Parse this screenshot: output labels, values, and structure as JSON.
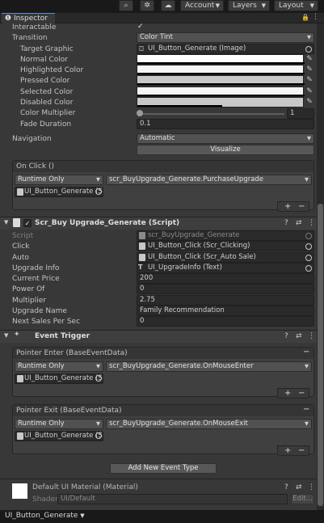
{
  "toolbar": {
    "account_label": "Account",
    "layers_label": "Layers",
    "layout_label": "Layout"
  },
  "tab": {
    "title": "Inspector"
  },
  "button_section": {
    "interactable_label": "Interactable",
    "interactable_checked": "✓",
    "transition_label": "Transition",
    "transition_value": "Color Tint",
    "target_graphic_label": "Target Graphic",
    "target_graphic_value": "UI_Button_Generate (Image)",
    "normal_color_label": "Normal Color",
    "highlighted_color_label": "Highlighted Color",
    "pressed_color_label": "Pressed Color",
    "selected_color_label": "Selected Color",
    "disabled_color_label": "Disabled Color",
    "color_multiplier_label": "Color Multiplier",
    "color_multiplier_value": "1",
    "fade_duration_label": "Fade Duration",
    "fade_duration_value": "0.1",
    "navigation_label": "Navigation",
    "navigation_value": "Automatic",
    "visualize_label": "Visualize",
    "onclick_header": "On Click ()",
    "onclick_runtime": "Runtime Only",
    "onclick_function": "scr_BuyUpgrade_Generate.PurchaseUpgrade",
    "onclick_object": "UI_Button_Generate (Sc"
  },
  "script_component": {
    "title": "Scr_Buy Upgrade_Generate (Script)",
    "fields": [
      {
        "label": "Script",
        "value": "scr_BuyUpgrade_Generate",
        "dim": true
      },
      {
        "label": "Click",
        "value": "UI_Button_Click (Scr_Clicking)"
      },
      {
        "label": "Auto",
        "value": "UI_Button_Click (Scr_Auto Sale)"
      },
      {
        "label": "Upgrade Info",
        "value": "UI_UpgradeInfo (Text)"
      },
      {
        "label": "Current Price",
        "value": "200"
      },
      {
        "label": "Power Of",
        "value": "0"
      },
      {
        "label": "Multiplier",
        "value": "2.75"
      },
      {
        "label": "Upgrade Name",
        "value": "Family Recommendation"
      },
      {
        "label": "Next Sales Per Sec",
        "value": "0"
      }
    ]
  },
  "event_trigger": {
    "title": "Event Trigger",
    "entries": [
      {
        "header": "Pointer Enter (BaseEventData)",
        "runtime": "Runtime Only",
        "function": "scr_BuyUpgrade_Generate.OnMouseEnter",
        "object": "UI_Button_Generate (Sc"
      },
      {
        "header": "Pointer Exit (BaseEventData)",
        "runtime": "Runtime Only",
        "function": "scr_BuyUpgrade_Generate.OnMouseExit",
        "object": "UI_Button_Generate (Sc"
      }
    ],
    "add_event_label": "Add New Event Type"
  },
  "material": {
    "title": "Default UI Material (Material)",
    "shader_label": "Shader",
    "shader_value": "UI/Default",
    "edit_label": "Edit..."
  },
  "bottom_bar": {
    "object_name": "UI_Button_Generate"
  },
  "colors": {
    "accent": "#5a8ed6",
    "panel": "#383838",
    "field": "#2a2a2a"
  }
}
